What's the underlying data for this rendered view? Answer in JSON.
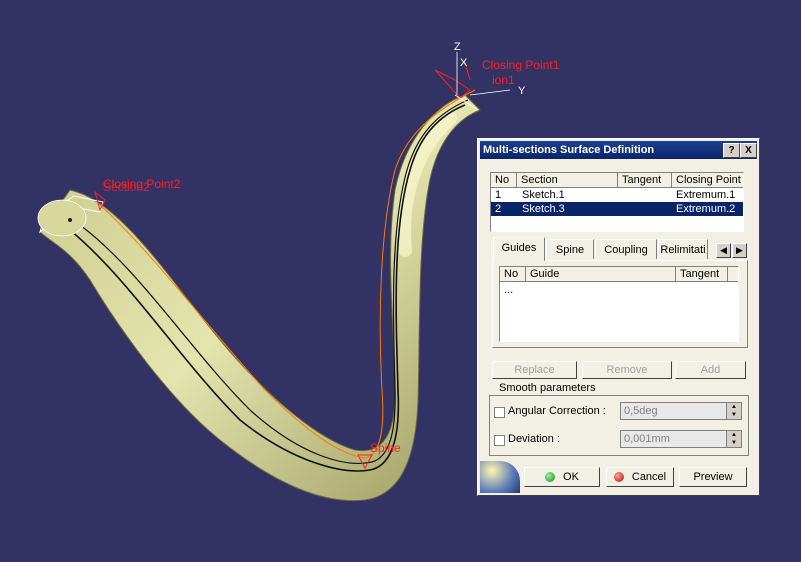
{
  "viewport": {
    "annotations": {
      "closing_point_1": "Closing Point1",
      "closing_point_2": "Closing Point2",
      "section_1": "ion1",
      "section_2": "Section2",
      "spine": "Spine"
    },
    "axes": {
      "x": "X",
      "y": "Y",
      "z": "Z"
    }
  },
  "dialog": {
    "title": "Multi-sections Surface Definition",
    "help_btn": "?",
    "close_btn": "X",
    "sections_table": {
      "headers": [
        "No",
        "Section",
        "Tangent",
        "Closing Point"
      ],
      "rows": [
        {
          "no": "1",
          "section": "Sketch.1",
          "tangent": "",
          "closing": "Extremum.1"
        },
        {
          "no": "2",
          "section": "Sketch.3",
          "tangent": "",
          "closing": "Extremum.2"
        }
      ]
    },
    "tabs": [
      "Guides",
      "Spine",
      "Coupling",
      "Relimitati"
    ],
    "guides_table": {
      "headers": [
        "No",
        "Guide",
        "Tangent"
      ],
      "rows": [
        {
          "no": "...",
          "guide": "",
          "tangent": ""
        }
      ]
    },
    "buttons": {
      "replace": "Replace",
      "remove": "Remove",
      "add": "Add"
    },
    "smooth": {
      "title": "Smooth parameters",
      "angular_label": "Angular Correction :",
      "angular_value": "0,5deg",
      "deviation_label": "Deviation :",
      "deviation_value": "0,001mm"
    },
    "footer": {
      "ok": "OK",
      "cancel": "Cancel",
      "preview": "Preview"
    }
  },
  "colors": {
    "background": "#323264",
    "surface": "#e6e6a8",
    "annotation": "#ff2020"
  }
}
